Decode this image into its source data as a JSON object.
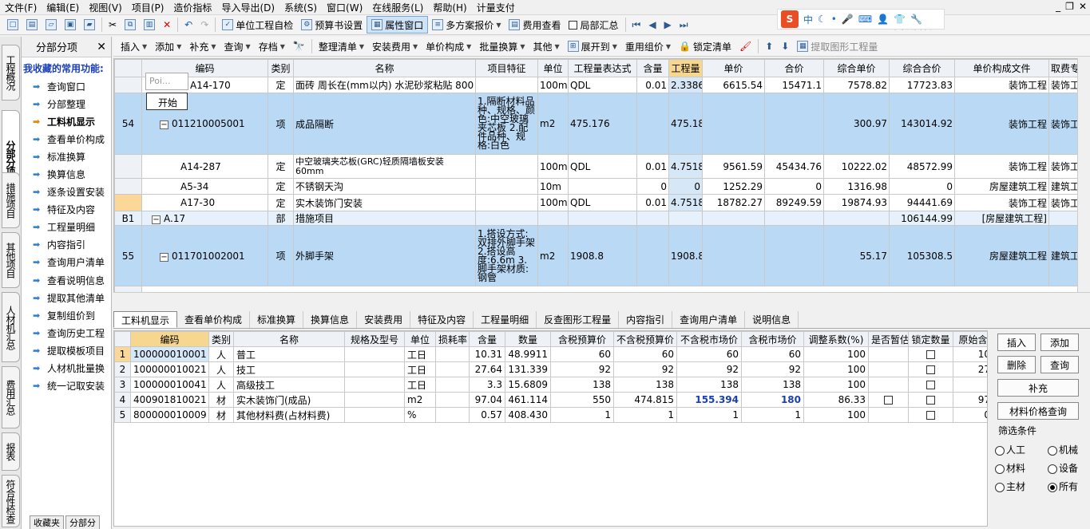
{
  "menu": {
    "items": [
      "文件(F)",
      "编辑(E)",
      "视图(V)",
      "项目(P)",
      "造价指标",
      "导入导出(D)",
      "系统(S)",
      "窗口(W)",
      "在线服务(L)",
      "帮助(H)",
      "计量支付"
    ]
  },
  "toolbar1": {
    "check": "单位工程自检",
    "preview": "预算书设置",
    "attr": "属性窗口",
    "multi": "多方案报价",
    "fee": "费用查看",
    "local": "局部汇总",
    "back": "返回项目管理"
  },
  "ime": {
    "logo": "S",
    "lang": "中"
  },
  "toolbar2": {
    "items": [
      "插入",
      "添加",
      "补充",
      "查询",
      "存档",
      "整理清单",
      "安装费用",
      "单价构成",
      "批量换算",
      "其他",
      "展开到",
      "重用组价",
      "锁定清单",
      "提取图形工程量"
    ]
  },
  "vtabs": [
    "工程概况",
    "分部分项",
    "措施项目",
    "其他项目",
    "人材机汇总",
    "费用汇总",
    "报表",
    "符合性检查"
  ],
  "leftpanel": {
    "title": "分部分项",
    "close": "✕",
    "fav_title": "我收藏的常用功能:",
    "items": [
      "查询窗口",
      "分部整理",
      "工料机显示",
      "查看单价构成",
      "标准换算",
      "换算信息",
      "逐条设置安装",
      "特征及内容",
      "工程量明细",
      "内容指引",
      "查询用户清单",
      "查看说明信息",
      "提取其他清单",
      "复制组价到",
      "查询历史工程",
      "提取模板项目",
      "人材机批量换",
      "统一记取安装"
    ],
    "bottom_tabs": [
      "收藏夹",
      "分部分"
    ]
  },
  "main_grid": {
    "headers": [
      "编码",
      "类别",
      "名称",
      "项目特征",
      "单位",
      "工程量表达式",
      "含量",
      "工程量",
      "单价",
      "合价",
      "综合单价",
      "综合合价",
      "单价构成文件",
      "取费专业"
    ],
    "rows": [
      {
        "rn": "",
        "code": "A14-170",
        "type": "定",
        "name": "面砖 周长在(mm以内) 水泥砂浆粘贴 800",
        "feat": "",
        "unit": "100m2",
        "expr": "QDL",
        "qty": "0.01",
        "amt": "2.3386",
        "price": "6615.54",
        "total": "15471.1",
        "cu": "7578.82",
        "ct": "17723.83",
        "file": "装饰工程",
        "spec": "装饰工"
      },
      {
        "rn": "54",
        "code": "011210005001",
        "type": "项",
        "name": "成品隔断",
        "feat": "1.隔断材料品种、规格、颜色:中空玻璃夹芯板 2.配件品种、规格:白色",
        "unit": "m2",
        "expr": "475.176",
        "qty": "",
        "amt": "475.18",
        "price": "",
        "total": "",
        "cu": "300.97",
        "ct": "143014.92",
        "file": "装饰工程",
        "spec": "装饰工"
      },
      {
        "rn": "",
        "code": "A14-287",
        "type": "定",
        "name": "中空玻璃夹芯板(GRC)轻质隔墙板安装 60mm",
        "feat": "",
        "unit": "100m2",
        "expr": "QDL",
        "qty": "0.01",
        "amt": "4.7518",
        "price": "9561.59",
        "total": "45434.76",
        "cu": "10222.02",
        "ct": "48572.99",
        "file": "装饰工程",
        "spec": "装饰工"
      },
      {
        "rn": "",
        "code": "A5-34",
        "type": "定",
        "name": "不锈钢天沟",
        "feat": "",
        "unit": "10m",
        "expr": "",
        "qty": "0",
        "amt": "0",
        "price": "1252.29",
        "total": "0",
        "cu": "1316.98",
        "ct": "0",
        "file": "房屋建筑工程",
        "spec": "建筑工程1"
      },
      {
        "rn": "",
        "code": "A17-30",
        "type": "定",
        "name": "实木装饰门安装",
        "feat": "",
        "unit": "100m2",
        "expr": "QDL",
        "qty": "0.01",
        "amt": "4.7518",
        "price": "18782.27",
        "total": "89249.59",
        "cu": "19874.93",
        "ct": "94441.69",
        "file": "装饰工程",
        "spec": "装饰工"
      },
      {
        "rn": "B1",
        "code": "A.17",
        "type": "部",
        "name": "措施项目",
        "feat": "",
        "unit": "",
        "expr": "",
        "qty": "",
        "amt": "",
        "price": "",
        "total": "",
        "cu": "",
        "ct": "106144.99",
        "file": "[房屋建筑工程]",
        "spec": ""
      },
      {
        "rn": "55",
        "code": "011701002001",
        "type": "项",
        "name": "外脚手架",
        "feat": "1.搭设方式:双排外脚手架 2.搭设高度:6.6m 3.脚手架材质:钢管",
        "unit": "m2",
        "expr": "1908.8",
        "qty": "",
        "amt": "1908.8",
        "price": "",
        "total": "",
        "cu": "55.17",
        "ct": "105308.5",
        "file": "房屋建筑工程",
        "spec": "建筑工程1"
      }
    ]
  },
  "popup": {
    "hint": "Poi...",
    "start": "开始"
  },
  "bottom_tabs": [
    "工料机显示",
    "查看单价构成",
    "标准换算",
    "换算信息",
    "安装费用",
    "特征及内容",
    "工程量明细",
    "反查图形工程量",
    "内容指引",
    "查询用户清单",
    "说明信息"
  ],
  "bottom_grid": {
    "headers": [
      "编码",
      "类别",
      "名称",
      "规格及型号",
      "单位",
      "损耗率",
      "含量",
      "数量",
      "含税预算价",
      "不含税预算价",
      "不含税市场价",
      "含税市场价",
      "调整系数(%)",
      "是否暂估",
      "锁定数量",
      "原始含"
    ],
    "rows": [
      {
        "n": "1",
        "code": "100000010001",
        "type": "人",
        "name": "普工",
        "spec": "",
        "unit": "工日",
        "loss": "",
        "qty": "10.31",
        "cnt": "48.9911",
        "tb": "60",
        "ntb": "60",
        "ntm": "60",
        "tm": "60",
        "adj": "100",
        "est": false,
        "lock": true,
        "orig": "10"
      },
      {
        "n": "2",
        "code": "100000010021",
        "type": "人",
        "name": "技工",
        "spec": "",
        "unit": "工日",
        "loss": "",
        "qty": "27.64",
        "cnt": "131.339",
        "tb": "92",
        "ntb": "92",
        "ntm": "92",
        "tm": "92",
        "adj": "100",
        "est": false,
        "lock": true,
        "orig": "27"
      },
      {
        "n": "3",
        "code": "100000010041",
        "type": "人",
        "name": "高级技工",
        "spec": "",
        "unit": "工日",
        "loss": "",
        "qty": "3.3",
        "cnt": "15.6809",
        "tb": "138",
        "ntb": "138",
        "ntm": "138",
        "tm": "138",
        "adj": "100",
        "est": false,
        "lock": true,
        "orig": ""
      },
      {
        "n": "4",
        "code": "400901810021",
        "type": "材",
        "name": "实木装饰门(成品)",
        "spec": "",
        "unit": "m2",
        "loss": "",
        "qty": "97.04",
        "cnt": "461.114",
        "tb": "550",
        "ntb": "474.815",
        "ntm": "155.394",
        "tm": "180",
        "adj": "86.33",
        "est": true,
        "lock": true,
        "orig": "97"
      },
      {
        "n": "5",
        "code": "800000010009",
        "type": "材",
        "name": "其他材料费(占材料费)",
        "spec": "",
        "unit": "%",
        "loss": "",
        "qty": "0.57",
        "cnt": "408.430",
        "tb": "1",
        "ntb": "1",
        "ntm": "1",
        "tm": "1",
        "adj": "100",
        "est": false,
        "lock": true,
        "orig": "0"
      }
    ]
  },
  "right_panel": {
    "insert": "插入",
    "add": "添加",
    "delete": "删除",
    "query": "查询",
    "supplement": "补充",
    "price_query": "材料价格查询",
    "filter_title": "筛选条件",
    "filters": [
      {
        "label": "人工",
        "on": false
      },
      {
        "label": "机械",
        "on": false
      },
      {
        "label": "材料",
        "on": false
      },
      {
        "label": "设备",
        "on": false
      },
      {
        "label": "主材",
        "on": false
      },
      {
        "label": "所有",
        "on": true
      }
    ]
  }
}
